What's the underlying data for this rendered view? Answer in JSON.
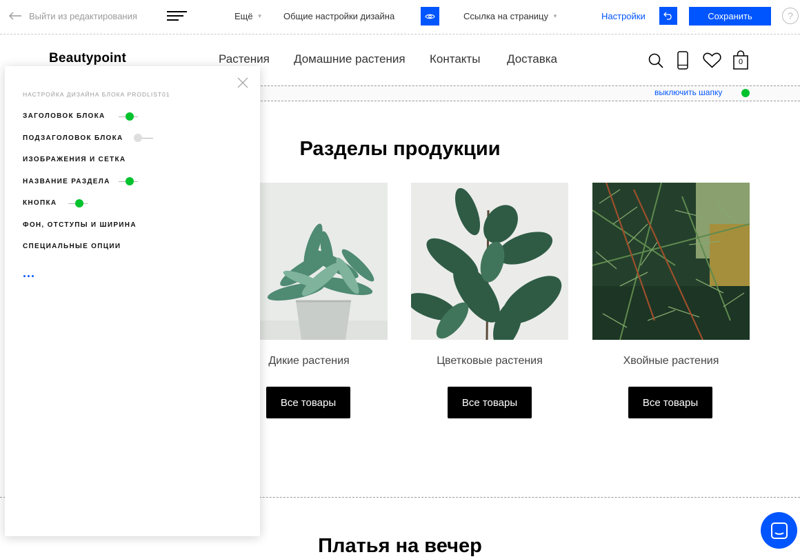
{
  "toolbar": {
    "exit_label": "Выйти из редактирования",
    "more_label": "Ещё",
    "design_label": "Общие настройки дизайна",
    "page_link_label": "Ссылка на страницу",
    "settings_label": "Настройки",
    "save_label": "Сохранить",
    "help_label": "?"
  },
  "site": {
    "logo": "Beautypoint",
    "nav": [
      "Растения",
      "Домашние растения",
      "Контакты",
      "Доставка"
    ],
    "cart_count": "0",
    "header_toggle_label": "выключить шапку"
  },
  "panel": {
    "title": "НАСТРОЙКА ДИЗАЙНА БЛОКА PRODLIST01",
    "options": [
      {
        "label": "ЗАГОЛОВОК БЛОКА",
        "toggle": "on"
      },
      {
        "label": "ПОДЗАГОЛОВОК БЛОКА",
        "toggle": "off"
      },
      {
        "label": "ИЗОБРАЖЕНИЯ И СЕТКА",
        "toggle": "none"
      },
      {
        "label": "НАЗВАНИЕ РАЗДЕЛА",
        "toggle": "on"
      },
      {
        "label": "КНОПКА",
        "toggle": "on"
      },
      {
        "label": "ФОН, ОТСТУПЫ И ШИРИНА",
        "toggle": "none"
      },
      {
        "label": "СПЕЦИАЛЬНЫЕ ОПЦИИ",
        "toggle": "none"
      }
    ],
    "more": "..."
  },
  "main": {
    "section_title": "Разделы продукции",
    "cards": [
      {
        "caption": "Дикие растения",
        "button": "Все товары"
      },
      {
        "caption": "Цветковые растения",
        "button": "Все товары"
      },
      {
        "caption": "Хвойные растения",
        "button": "Все товары"
      }
    ],
    "next_section_title": "Платья на вечер"
  },
  "colors": {
    "accent": "#0055ff",
    "toggle_on": "#00c22d",
    "button_bg": "#000000"
  }
}
